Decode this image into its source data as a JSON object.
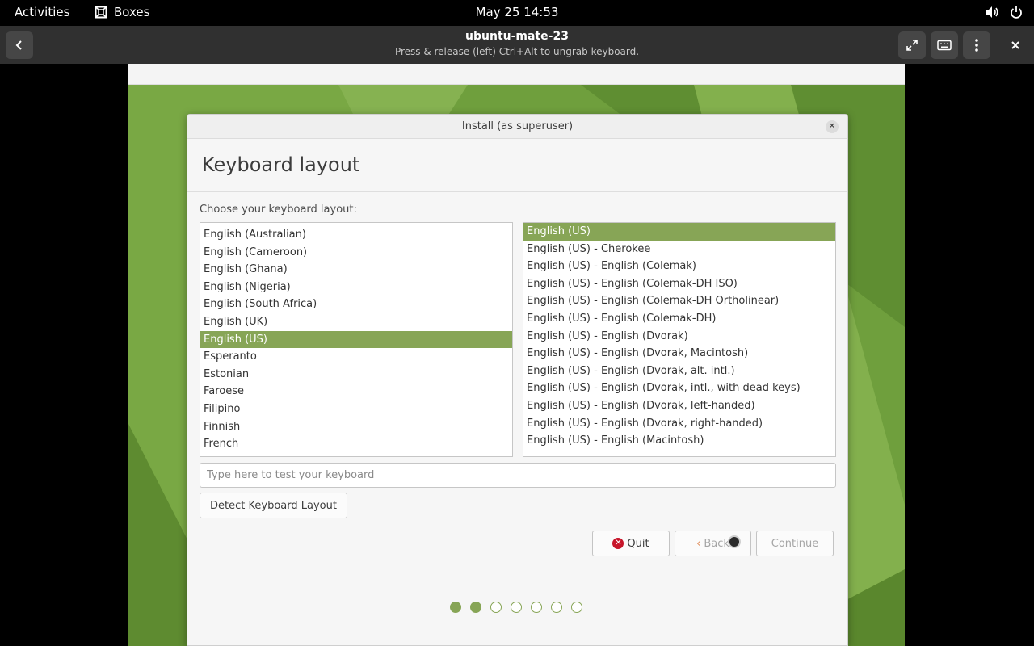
{
  "topbar": {
    "activities": "Activities",
    "app_name": "Boxes",
    "app_icon": "boxes-icon",
    "clock": "May 25  14:53",
    "volume_icon": "volume-icon",
    "power_icon": "power-icon"
  },
  "header": {
    "title": "ubuntu-mate-23",
    "subtitle": "Press & release (left) Ctrl+Alt to ungrab keyboard.",
    "back_icon": "chevron-left-icon",
    "fullscreen_icon": "fullscreen-icon",
    "keyboard_icon": "keyboard-icon",
    "menu_icon": "kebab-menu-icon",
    "close_icon": "close-icon"
  },
  "installer": {
    "window_title": "Install (as superuser)",
    "heading": "Keyboard layout",
    "choose_label": "Choose your keyboard layout:",
    "layouts": [
      "English (Australian)",
      "English (Cameroon)",
      "English (Ghana)",
      "English (Nigeria)",
      "English (South Africa)",
      "English (UK)",
      "English (US)",
      "Esperanto",
      "Estonian",
      "Faroese",
      "Filipino",
      "Finnish",
      "French"
    ],
    "selected_layout": "English (US)",
    "variants": [
      "English (US)",
      "English (US) - Cherokee",
      "English (US) - English (Colemak)",
      "English (US) - English (Colemak-DH ISO)",
      "English (US) - English (Colemak-DH Ortholinear)",
      "English (US) - English (Colemak-DH)",
      "English (US) - English (Dvorak)",
      "English (US) - English (Dvorak, Macintosh)",
      "English (US) - English (Dvorak, alt. intl.)",
      "English (US) - English (Dvorak, intl., with dead keys)",
      "English (US) - English (Dvorak, left-handed)",
      "English (US) - English (Dvorak, right-handed)",
      "English (US) - English (Macintosh)"
    ],
    "selected_variant": "English (US)",
    "test_placeholder": "Type here to test your keyboard",
    "detect_button": "Detect Keyboard Layout",
    "quit_button": "Quit",
    "back_button": "Back",
    "continue_button": "Continue",
    "progress": {
      "total_steps": 7,
      "completed_steps": 2
    }
  },
  "colors": {
    "accent": "#87a556",
    "quit_red": "#c7162b",
    "desktop_green": "#6a9b3a"
  }
}
